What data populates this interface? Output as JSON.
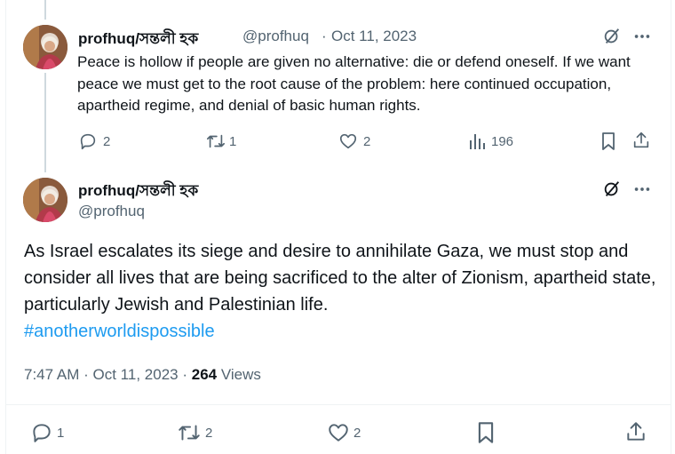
{
  "tweet1": {
    "display_name": "profhuq/সম্তলী হক",
    "handle": "@profhuq",
    "separator": "·",
    "date": "Oct 11, 2023",
    "text": "Peace is hollow if people are given no alternative: die or defend oneself.  If we want peace we must get to the root cause of the problem: here continued occupation, apartheid regime, and denial of basic human rights.",
    "replies": "2",
    "reposts": "1",
    "likes": "2",
    "views": "196"
  },
  "tweet2": {
    "display_name": "profhuq/সম্তলী হক",
    "handle": "@profhuq",
    "text": "As Israel escalates its siege and desire to annihilate Gaza, we must stop and consider all lives that are being sacrificed to the alter of Zionism, apartheid state, particularly Jewish and Palestinian life.",
    "hashtag": "#anotherworldispossible",
    "time": "7:47 AM",
    "separator": "·",
    "date": "Oct 11, 2023",
    "separator2": "·",
    "views_count": "264",
    "views_label": "Views",
    "replies": "1",
    "reposts": "2",
    "likes": "2"
  },
  "icons": [
    "grok-icon",
    "more-icon",
    "reply-icon",
    "repost-icon",
    "like-icon",
    "views-icon",
    "bookmark-icon",
    "share-icon"
  ],
  "colors": {
    "text": "#0f1419",
    "secondary": "#536471",
    "link": "#1d9bf0",
    "border": "#eff3f4"
  }
}
